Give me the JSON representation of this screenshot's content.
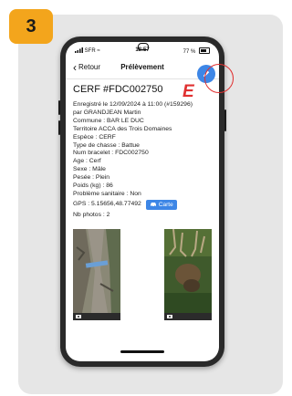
{
  "step": "3",
  "annotation_letter": "E",
  "status_bar": {
    "carrier": "SFR",
    "time": "18:57",
    "battery": "77 %"
  },
  "nav": {
    "back_label": "Retour",
    "title": "Prélèvement"
  },
  "record": {
    "title": "CERF #FDC002750",
    "lines": [
      "Enregistré le 12/09/2024 à 11:00 (#159296)",
      "par GRANDJEAN Martin",
      "Commune : BAR LE DUC",
      "Territoire   ACCA des Trois Domaines",
      "Espèce : CERF",
      "Type de chasse : Battue",
      "Num bracelet : FDC002750",
      "Age : Cerf",
      "Sexe : Mâle",
      "Pesée : Plein",
      "Poids (kg) : 86",
      "Problème sanitaire : Non"
    ],
    "gps": "GPS : 5.15656,48.77492",
    "map_button": "Carte",
    "photos_count": "Nb photos : 2"
  },
  "icons": {
    "edit": "pencil-icon",
    "back": "chevron-left-icon",
    "map": "car-icon",
    "camera": "camera-icon"
  },
  "colors": {
    "badge": "#f3a51c",
    "accent_blue": "#3d86e6",
    "annotation_red": "#e03030"
  }
}
